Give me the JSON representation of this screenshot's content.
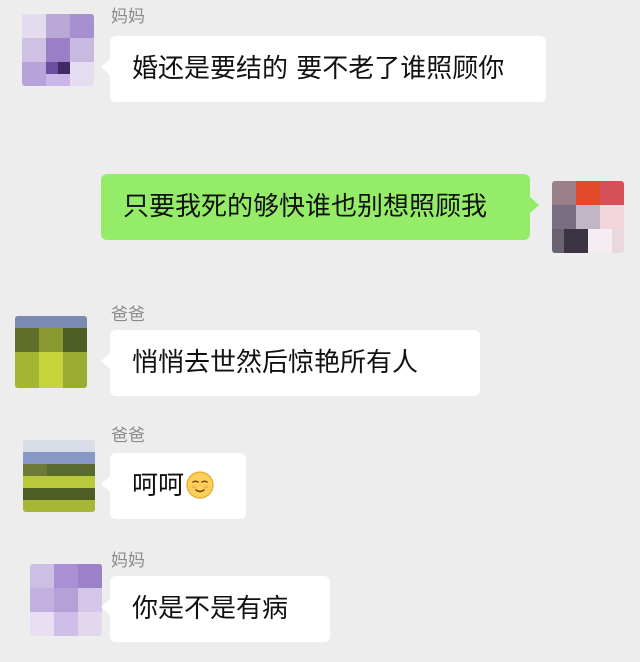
{
  "messages": [
    {
      "sender": "妈妈",
      "direction": "incoming",
      "avatar": "avatar-pixelated-purple",
      "text": "婚还是要结的 要不老了谁照顾你"
    },
    {
      "sender": "",
      "direction": "outgoing",
      "avatar": "avatar-pixelated-red",
      "text": "只要我死的够快谁也别想照顾我"
    },
    {
      "sender": "爸爸",
      "direction": "incoming",
      "avatar": "avatar-pixelated-green",
      "text": "悄悄去世然后惊艳所有人"
    },
    {
      "sender": "爸爸",
      "direction": "incoming",
      "avatar": "avatar-pixelated-green",
      "text": "呵呵",
      "emoji": "smirk-face-icon"
    },
    {
      "sender": "妈妈",
      "direction": "incoming",
      "avatar": "avatar-pixelated-purple",
      "text": "你是不是有病"
    }
  ],
  "colors": {
    "background": "#ededed",
    "incoming_bubble": "#ffffff",
    "outgoing_bubble": "#95ec69",
    "sender_name": "#8c8c8c",
    "text": "#111111"
  }
}
